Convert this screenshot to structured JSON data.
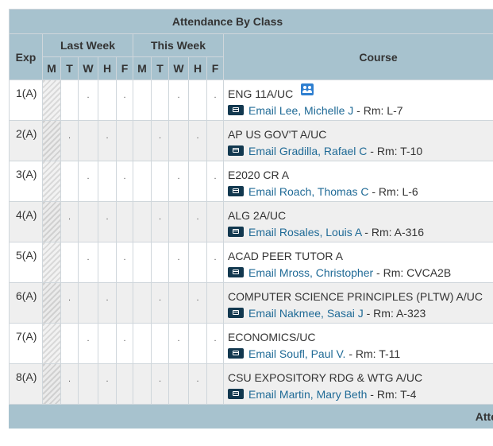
{
  "header": {
    "title": "Attendance By Class",
    "exp_label": "Exp",
    "last_week_label": "Last Week",
    "this_week_label": "This Week",
    "course_label": "Course",
    "days": [
      "M",
      "T",
      "W",
      "H",
      "F"
    ]
  },
  "rows": [
    {
      "exp": "1(A)",
      "course": "ENG 11A/UC",
      "email_label": "Email",
      "teacher": "Lee, Michelle J",
      "room": " - Rm: L-7",
      "has_roster_icon": true,
      "last_week": [
        "",
        "",
        ".",
        "",
        "."
      ],
      "this_week": [
        "",
        "",
        ".",
        "",
        "."
      ]
    },
    {
      "exp": "2(A)",
      "course": "AP US GOV'T A/UC",
      "email_label": "Email",
      "teacher": "Gradilla, Rafael C",
      "room": " - Rm: T-10",
      "last_week": [
        "",
        ".",
        "",
        ".",
        ""
      ],
      "this_week": [
        "",
        ".",
        "",
        ".",
        ""
      ]
    },
    {
      "exp": "3(A)",
      "course": "E2020 CR A",
      "email_label": "Email",
      "teacher": "Roach, Thomas C",
      "room": " - Rm: L-6",
      "last_week": [
        "",
        "",
        ".",
        "",
        "."
      ],
      "this_week": [
        "",
        "",
        ".",
        "",
        "."
      ]
    },
    {
      "exp": "4(A)",
      "course": "ALG 2A/UC",
      "email_label": "Email",
      "teacher": "Rosales, Louis A",
      "room": " - Rm: A-316",
      "last_week": [
        "",
        ".",
        "",
        ".",
        ""
      ],
      "this_week": [
        "",
        ".",
        "",
        ".",
        ""
      ]
    },
    {
      "exp": "5(A)",
      "course": "ACAD PEER TUTOR A",
      "email_label": "Email",
      "teacher": "Mross, Christopher",
      "room": " - Rm: CVCA2B",
      "last_week": [
        "",
        "",
        ".",
        "",
        "."
      ],
      "this_week": [
        "",
        "",
        ".",
        "",
        "."
      ]
    },
    {
      "exp": "6(A)",
      "course": "COMPUTER SCIENCE PRINCIPLES (PLTW) A/UC",
      "email_label": "Email",
      "teacher": "Nakmee, Sasai J",
      "room": " - Rm: A-323",
      "last_week": [
        "",
        ".",
        "",
        ".",
        ""
      ],
      "this_week": [
        "",
        ".",
        "",
        ".",
        ""
      ]
    },
    {
      "exp": "7(A)",
      "course": "ECONOMICS/UC",
      "email_label": "Email",
      "teacher": "Soufl, Paul V.",
      "room": " - Rm: T-11",
      "last_week": [
        "",
        "",
        ".",
        "",
        "."
      ],
      "this_week": [
        "",
        "",
        ".",
        "",
        "."
      ]
    },
    {
      "exp": "8(A)",
      "course": "CSU EXPOSITORY RDG & WTG A/UC",
      "email_label": "Email",
      "teacher": "Martin, Mary Beth",
      "room": " - Rm: T-4",
      "last_week": [
        "",
        ".",
        "",
        ".",
        ""
      ],
      "this_week": [
        "",
        ".",
        "",
        ".",
        ""
      ]
    }
  ],
  "footer": {
    "label": "Atte"
  },
  "colors": {
    "header_bg": "#a7c2ce",
    "link": "#1f6a96",
    "email_icon": "#12384f",
    "roster_icon": "#2f7fd0"
  },
  "icons": {
    "email": "email-icon",
    "roster": "roster-icon"
  }
}
